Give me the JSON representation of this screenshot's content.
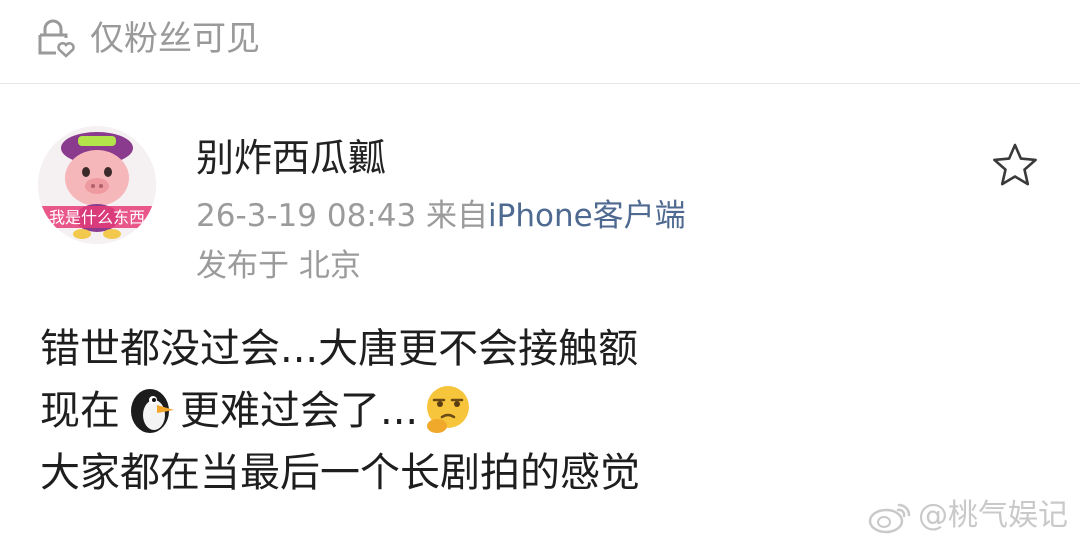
{
  "header": {
    "visibility_label": "仅粉丝可见",
    "icon": "lock-heart-icon"
  },
  "post": {
    "author": {
      "name": "别炸西瓜瓤",
      "avatar_caption": "我是什么东西"
    },
    "date": "26-3-19 08:43",
    "source_prefix": "来自",
    "source_client": "iPhone客户端",
    "location": "发布于 北京",
    "body": {
      "line1": "错世都没过会...大唐更不会接触额",
      "line2_start": "现在",
      "line2_emoji": "penguin-emoji",
      "line2_end": "更难过会了...",
      "line2_emoji_end": "thinking-eyeroll-emoji",
      "line3": "大家都在当最后一个长剧拍的感觉"
    },
    "favorite_icon": "star-icon"
  },
  "watermark": {
    "text": "@桃气娱记",
    "icon": "weibo-logo-icon"
  },
  "colors": {
    "accent_link": "#4f6a91",
    "muted_text": "#9b9b9b",
    "body_text": "#1e1e1e"
  }
}
